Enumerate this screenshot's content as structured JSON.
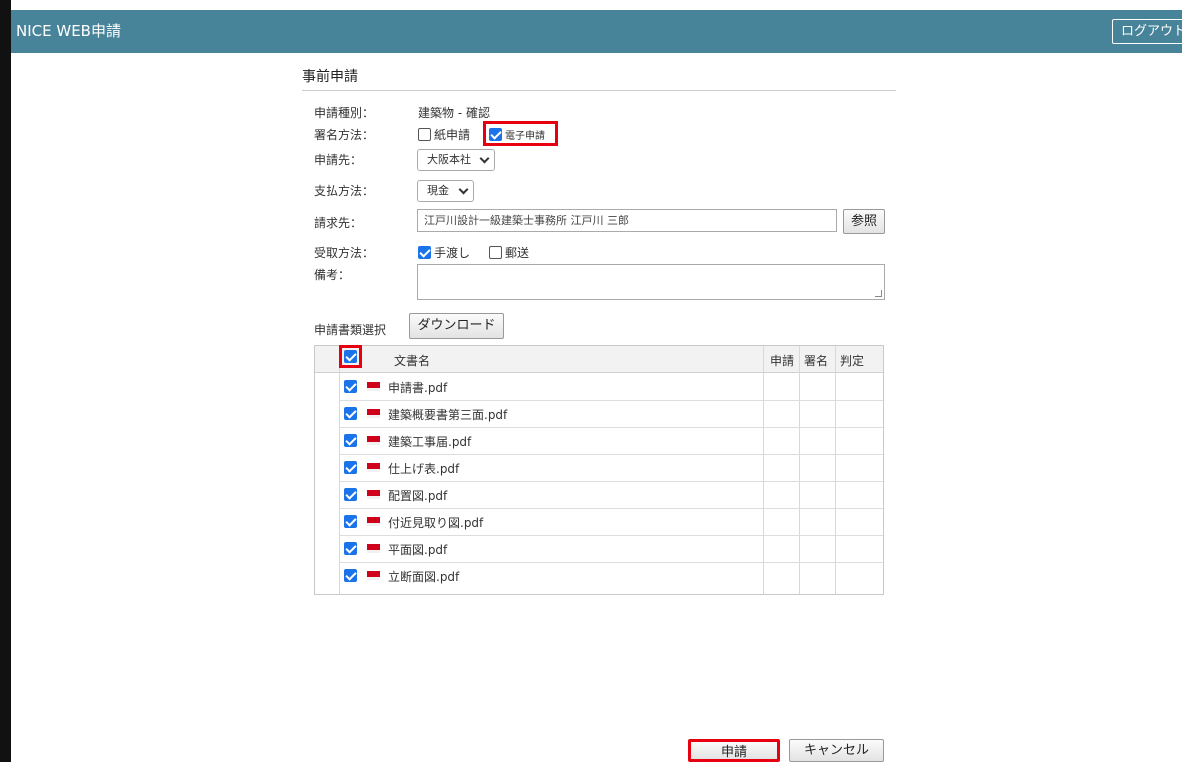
{
  "header": {
    "title": "NICE WEB申請",
    "logout_label": "ログアウト"
  },
  "section": {
    "title": "事前申請"
  },
  "form": {
    "type_label": "申請種別：",
    "type_value": "建築物 - 確認",
    "sign_label": "署名方法：",
    "sign_paper": "紙申請",
    "sign_paper_checked": false,
    "sign_electronic": "電子申請",
    "sign_electronic_checked": true,
    "dest_label": "申請先：",
    "dest_value": "大阪本社",
    "payment_label": "支払方法：",
    "payment_value": "現金",
    "billing_label": "請求先：",
    "billing_value": "江戸川設計一級建築士事務所 江戸川 三郎",
    "reference_button": "参照",
    "receive_label": "受取方法：",
    "receive_hand": "手渡し",
    "receive_hand_checked": true,
    "receive_mail": "郵送",
    "receive_mail_checked": false,
    "notes_label": "備考："
  },
  "documents": {
    "section_label": "申請書類選択",
    "download_button": "ダウンロード",
    "header_name": "文書名",
    "header_apply": "申請",
    "header_sign": "署名",
    "header_judge": "判定",
    "select_all_checked": true,
    "icon": "pdf-icon",
    "items": [
      {
        "name": "申請書.pdf",
        "checked": true
      },
      {
        "name": "建築概要書第三面.pdf",
        "checked": true
      },
      {
        "name": "建築工事届.pdf",
        "checked": true
      },
      {
        "name": "仕上げ表.pdf",
        "checked": true
      },
      {
        "name": "配置図.pdf",
        "checked": true
      },
      {
        "name": "付近見取り図.pdf",
        "checked": true
      },
      {
        "name": "平面図.pdf",
        "checked": true
      },
      {
        "name": "立断面図.pdf",
        "checked": true
      }
    ]
  },
  "footer": {
    "apply_button": "申請",
    "cancel_button": "キャンセル"
  },
  "colors": {
    "header_bg": "#47849a",
    "highlight": "#e60012",
    "checkbox": "#1a73e8"
  }
}
